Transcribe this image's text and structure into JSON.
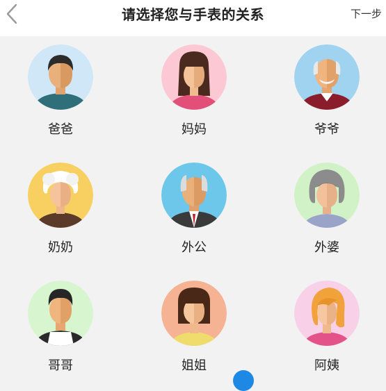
{
  "header": {
    "title": "请选择您与手表的关系",
    "next_label": "下一步",
    "back_icon": "chevron-left-icon"
  },
  "relations": [
    {
      "label": "爸爸",
      "bg": "#cfe7f7"
    },
    {
      "label": "妈妈",
      "bg": "#fbc8d4"
    },
    {
      "label": "爷爷",
      "bg": "#9fd3f0"
    },
    {
      "label": "奶奶",
      "bg": "#f7d061"
    },
    {
      "label": "外公",
      "bg": "#6cc7ea"
    },
    {
      "label": "外婆",
      "bg": "#d1f1c6"
    },
    {
      "label": "哥哥",
      "bg": "#d7f5cf"
    },
    {
      "label": "姐姐",
      "bg": "#f6b393"
    },
    {
      "label": "阿姨",
      "bg": "#f8d0e8"
    }
  ]
}
